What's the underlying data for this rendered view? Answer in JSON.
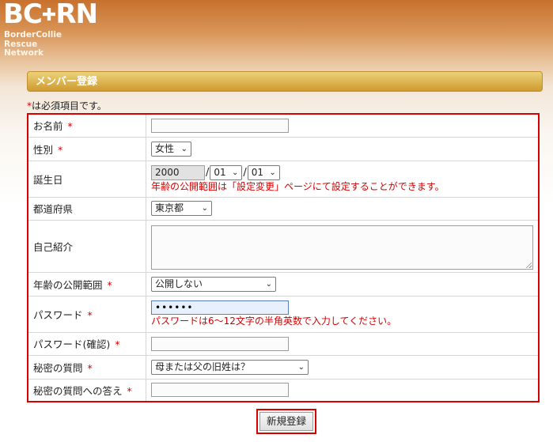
{
  "header": {
    "logo_mark": "BC",
    "logo_mark_end": "RN",
    "logo_cross": "✚",
    "logo_line1": "BorderCollie",
    "logo_line2": "Rescue",
    "logo_line3": "Network"
  },
  "page_title": "メンバー登録",
  "required_note": {
    "asterisk": "*",
    "text": "は必須項目です。"
  },
  "fields": {
    "name": {
      "label": "お名前",
      "required": "*",
      "value": ""
    },
    "gender": {
      "label": "性別",
      "required": "*",
      "selected": "女性"
    },
    "birthday": {
      "label": "誕生日",
      "year": "2000",
      "month": "01",
      "day": "01",
      "separator": "/",
      "hint": "年齢の公開範囲は「設定変更」ページにて設定することができます。"
    },
    "prefecture": {
      "label": "都道府県",
      "selected": "東京都"
    },
    "intro": {
      "label": "自己紹介",
      "value": ""
    },
    "age_visibility": {
      "label": "年齢の公開範囲",
      "required": "*",
      "selected": "公開しない"
    },
    "password": {
      "label": "パスワード",
      "required": "*",
      "value": "••••••",
      "hint": "パスワードは6～12文字の半角英数で入力してください。"
    },
    "password_confirm": {
      "label": "パスワード(確認)",
      "required": "*",
      "value": ""
    },
    "secret_question": {
      "label": "秘密の質問",
      "required": "*",
      "selected": "母または父の旧姓は？"
    },
    "secret_answer": {
      "label": "秘密の質問への答え",
      "required": "*",
      "value": ""
    }
  },
  "submit_label": "新規登録",
  "colors": {
    "header_top": "#c8712d",
    "title_bar": "#cf9a2e",
    "required": "#d40000",
    "highlight_border": "#d90000"
  },
  "icons": {
    "dropdown": "chevron-down-icon"
  }
}
